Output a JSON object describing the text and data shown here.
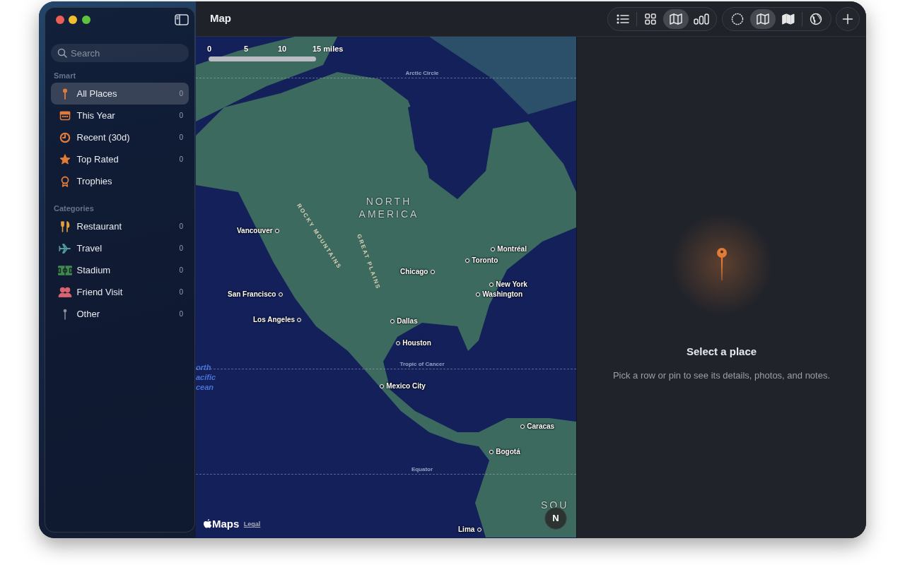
{
  "window": {
    "title": "Map"
  },
  "toolbar": {
    "groups": [
      {
        "buttons": [
          {
            "selected": false
          },
          {
            "selected": false
          },
          {
            "selected": true
          },
          {
            "selected": false
          }
        ]
      },
      {
        "buttons": [
          {
            "selected": false
          },
          {
            "selected": true
          },
          {
            "selected": false
          },
          {
            "selected": false
          }
        ]
      }
    ]
  },
  "sidebar": {
    "search": {
      "placeholder": "Search"
    },
    "sections": [
      {
        "title": "Smart",
        "items": [
          {
            "label": "All Places",
            "count": "0",
            "selected": true,
            "color": "#e07b39"
          },
          {
            "label": "This Year",
            "count": "0",
            "selected": false,
            "color": "#e07b39"
          },
          {
            "label": "Recent (30d)",
            "count": "0",
            "selected": false,
            "color": "#e07b39"
          },
          {
            "label": "Top Rated",
            "count": "0",
            "selected": false,
            "color": "#e07b39"
          },
          {
            "label": "Trophies",
            "selected": false,
            "color": "#e07b39"
          }
        ]
      },
      {
        "title": "Categories",
        "items": [
          {
            "label": "Restaurant",
            "count": "0",
            "selected": false,
            "color": "#e6a23c"
          },
          {
            "label": "Travel",
            "count": "0",
            "selected": false,
            "color": "#4f9a9c"
          },
          {
            "label": "Stadium",
            "count": "0",
            "selected": false,
            "color": "#3f8a55"
          },
          {
            "label": "Friend Visit",
            "count": "0",
            "selected": false,
            "color": "#d9636e"
          },
          {
            "label": "Other",
            "count": "0",
            "selected": false,
            "color": "#8a8f98"
          }
        ]
      }
    ]
  },
  "map": {
    "scale": {
      "labels": [
        "0",
        "5",
        "10",
        "15 miles"
      ]
    },
    "labels": [
      {
        "text": "Arctic Circle",
        "kind": "line"
      },
      {
        "text": "NORTH AMERICA",
        "kind": "region"
      },
      {
        "text": "ROCKY MOUNTAINS",
        "kind": "range"
      },
      {
        "text": "GREAT PLAINS",
        "kind": "range"
      },
      {
        "text": "Vancouver",
        "kind": "city"
      },
      {
        "text": "San Francisco",
        "kind": "city"
      },
      {
        "text": "Los Angeles",
        "kind": "city"
      },
      {
        "text": "Chicago",
        "kind": "city"
      },
      {
        "text": "Toronto",
        "kind": "city"
      },
      {
        "text": "Montréal",
        "kind": "city"
      },
      {
        "text": "New York",
        "kind": "city"
      },
      {
        "text": "Washington",
        "kind": "city"
      },
      {
        "text": "Dallas",
        "kind": "city"
      },
      {
        "text": "Houston",
        "kind": "city"
      },
      {
        "text": "orth acific cean",
        "kind": "ocean"
      },
      {
        "text": "Tropic of Cancer",
        "kind": "line"
      },
      {
        "text": "Mexico City",
        "kind": "city"
      },
      {
        "text": "Caracas",
        "kind": "city"
      },
      {
        "text": "Bogotá",
        "kind": "city"
      },
      {
        "text": "Equator",
        "kind": "line"
      },
      {
        "text": "Lima",
        "kind": "city"
      },
      {
        "text": "SOU",
        "kind": "region"
      }
    ],
    "attribution": {
      "brand": "Maps",
      "legal": "Legal"
    },
    "compass": "N"
  },
  "detail": {
    "title": "Select a place",
    "message": "Pick a row or pin to see its details, photos, and notes."
  }
}
